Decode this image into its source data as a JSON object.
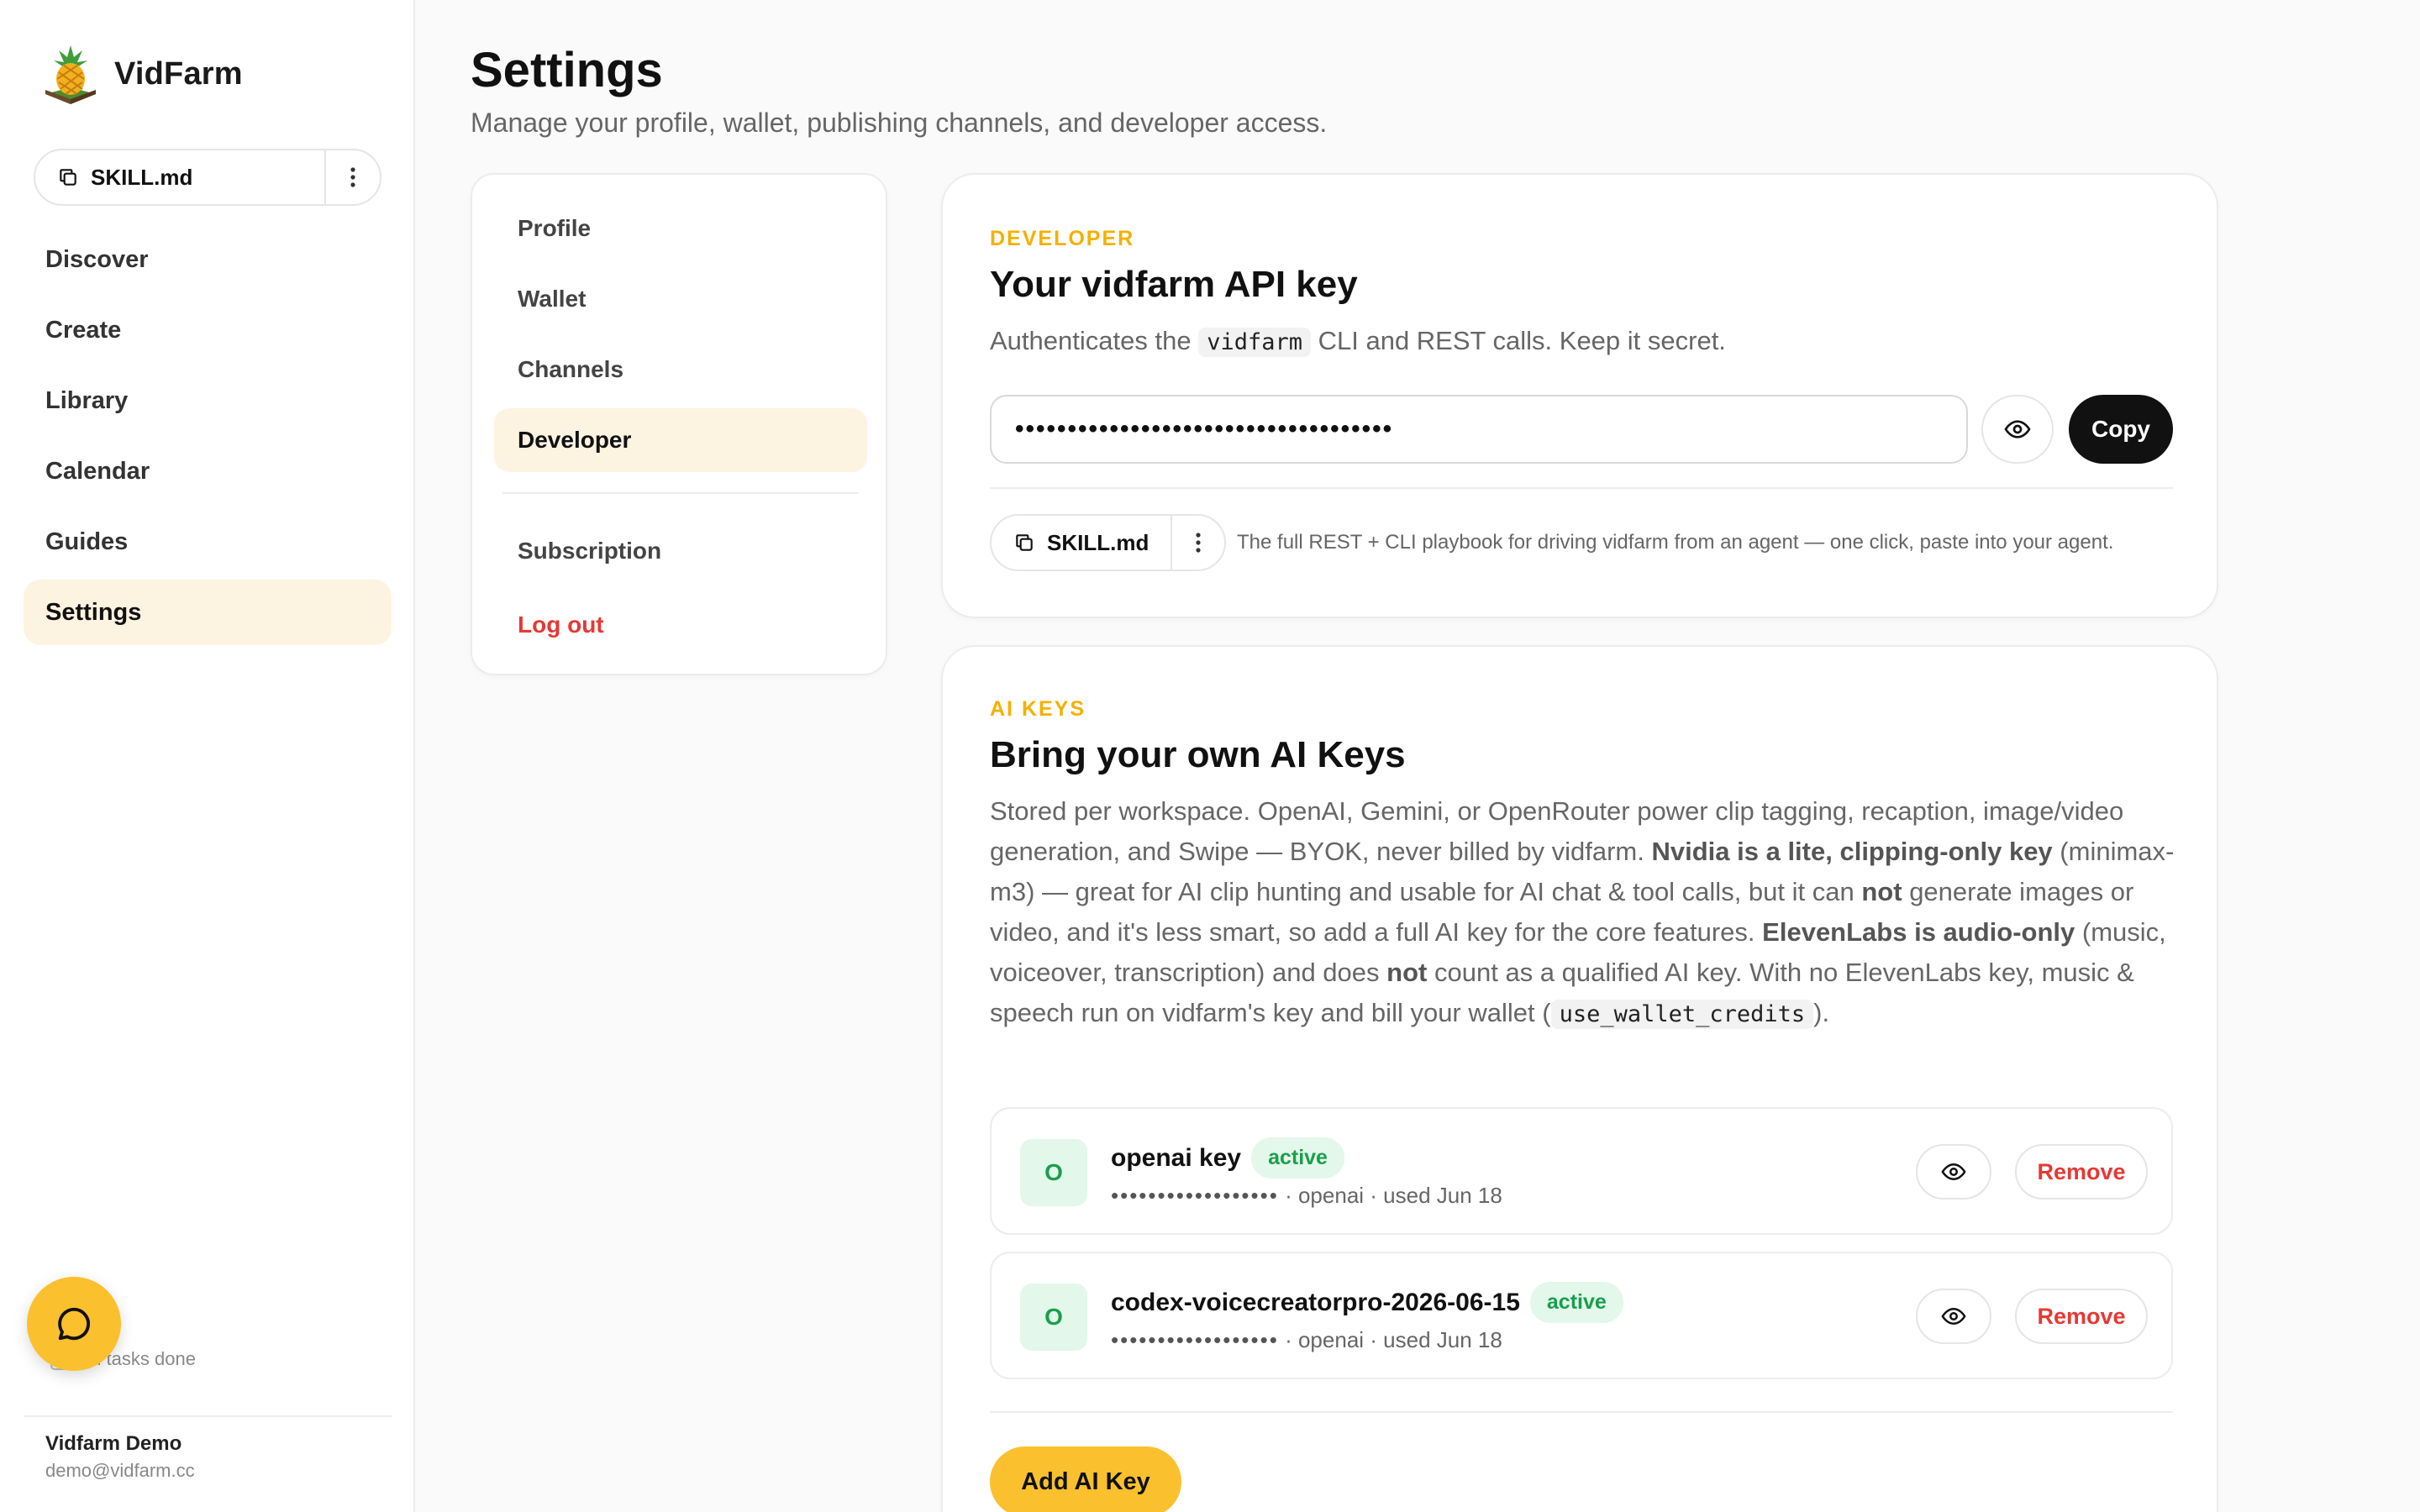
{
  "brand": {
    "name": "VidFarm"
  },
  "sidebar": {
    "skill_label": "SKILL.md",
    "items": [
      {
        "label": "Discover",
        "active": false
      },
      {
        "label": "Create",
        "active": false
      },
      {
        "label": "Library",
        "active": false
      },
      {
        "label": "Calendar",
        "active": false
      },
      {
        "label": "Guides",
        "active": false
      },
      {
        "label": "Settings",
        "active": true
      }
    ],
    "tasks_status": "All tasks done",
    "user": {
      "name": "Vidfarm Demo",
      "email": "demo@vidfarm.cc"
    }
  },
  "header": {
    "title": "Settings",
    "subtitle": "Manage your profile, wallet, publishing channels, and developer access."
  },
  "settings_menu": {
    "items": [
      {
        "label": "Profile",
        "active": false
      },
      {
        "label": "Wallet",
        "active": false
      },
      {
        "label": "Channels",
        "active": false
      },
      {
        "label": "Developer",
        "active": true
      }
    ],
    "subscription": "Subscription",
    "logout": "Log out"
  },
  "developer": {
    "eyebrow": "DEVELOPER",
    "title": "Your vidfarm API key",
    "desc_before": "Authenticates the",
    "desc_code": "vidfarm",
    "desc_after": "CLI and REST calls. Keep it secret.",
    "api_key_masked": "••••••••••••••••••••••••••••••••••••",
    "copy_label": "Copy",
    "skill_label": "SKILL.md",
    "skill_help": "The full REST + CLI playbook for driving vidfarm from an agent — one click, paste into your agent."
  },
  "ai_keys": {
    "eyebrow": "AI KEYS",
    "title": "Bring your own AI Keys",
    "desc": {
      "p1": "Stored per workspace. OpenAI, Gemini, or OpenRouter power clip tagging, recaption, image/video generation, and Swipe — BYOK, never billed by vidfarm.",
      "b1": "Nvidia is a lite, clipping-only key",
      "p2": "(minimax-m3) — great for AI clip hunting and usable for AI chat & tool calls, but it can",
      "b2": "not",
      "p3": "generate images or video, and it's less smart, so add a full AI key for the core features.",
      "b3": "ElevenLabs is audio-only",
      "p4": "(music, voiceover, transcription) and does",
      "b4": "not",
      "p5": "count as a qualified AI key. With no ElevenLabs key, music & speech run on vidfarm's key and bill your wallet (",
      "code": "use_wallet_credits",
      "p6": ")."
    },
    "keys": [
      {
        "avatar": "O",
        "name": "openai key",
        "status": "active",
        "masked": "••••••••••••••••••",
        "meta": "· openai · used Jun 18"
      },
      {
        "avatar": "O",
        "name": "codex-voicecreatorpro-2026-06-15",
        "status": "active",
        "masked": "••••••••••••••••••",
        "meta": "· openai · used Jun 18"
      }
    ],
    "remove_label": "Remove",
    "add_label": "Add AI Key"
  },
  "colors": {
    "accent": "#fbc02d",
    "eyebrow": "#f5b000",
    "active_bg": "#fdf3e1",
    "danger": "#e53935",
    "success": "#1a9e4f"
  }
}
